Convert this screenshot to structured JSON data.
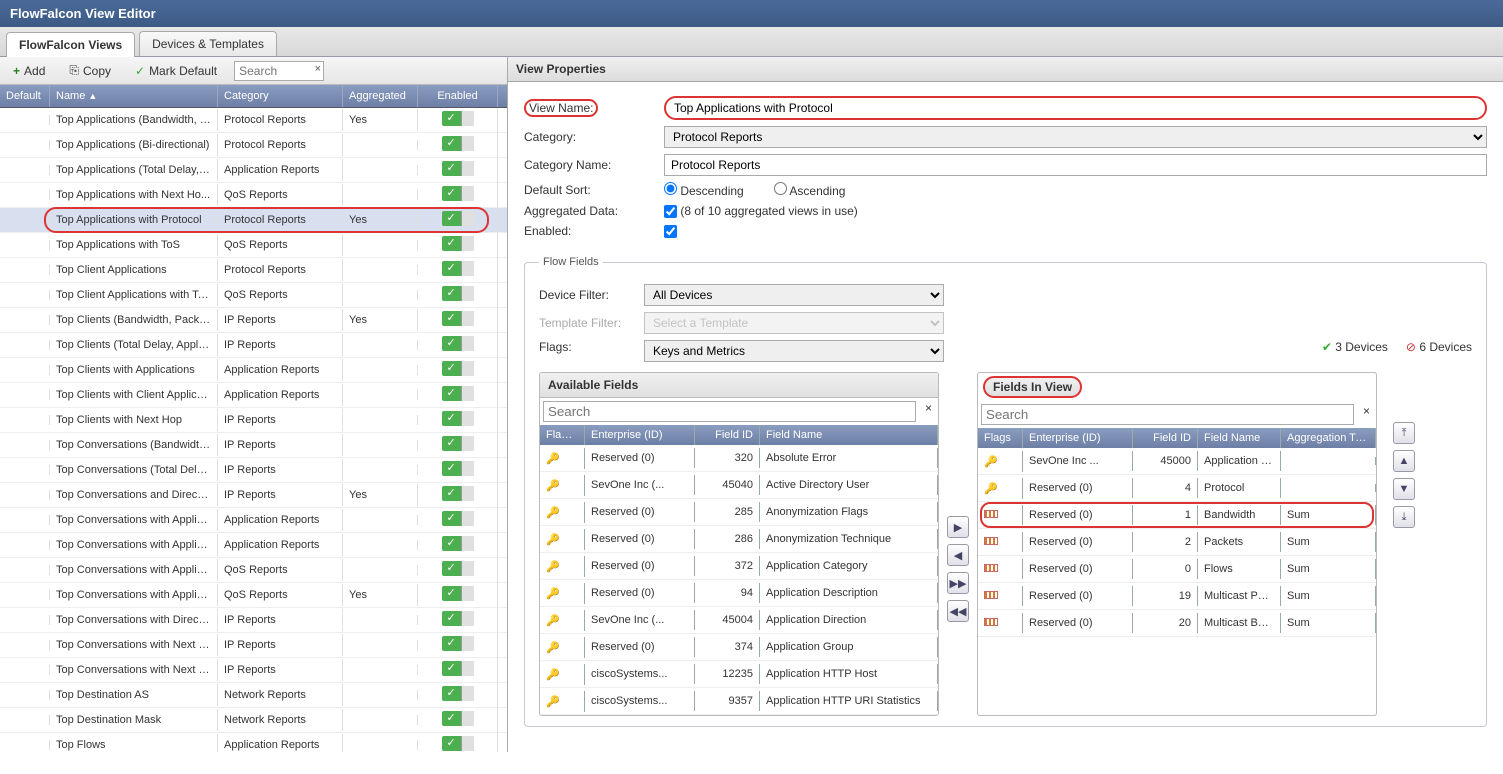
{
  "title": "FlowFalcon View Editor",
  "tabs": {
    "views": "FlowFalcon Views",
    "devices": "Devices & Templates"
  },
  "toolbar": {
    "add": "Add",
    "copy": "Copy",
    "mark": "Mark Default",
    "search_ph": "Search"
  },
  "grid": {
    "headers": {
      "default": "Default",
      "name": "Name",
      "category": "Category",
      "agg": "Aggregated",
      "enabled": "Enabled"
    },
    "rows": [
      {
        "name": "Top Applications (Bandwidth, P...",
        "cat": "Protocol Reports",
        "agg": "Yes"
      },
      {
        "name": "Top Applications (Bi-directional)",
        "cat": "Protocol Reports",
        "agg": ""
      },
      {
        "name": "Top Applications (Total Delay, ...",
        "cat": "Application Reports",
        "agg": ""
      },
      {
        "name": "Top Applications with Next Ho...",
        "cat": "QoS Reports",
        "agg": ""
      },
      {
        "name": "Top Applications with Protocol",
        "cat": "Protocol Reports",
        "agg": "Yes",
        "selected": true
      },
      {
        "name": "Top Applications with ToS",
        "cat": "QoS Reports",
        "agg": ""
      },
      {
        "name": "Top Client Applications",
        "cat": "Protocol Reports",
        "agg": ""
      },
      {
        "name": "Top Client Applications with ToS",
        "cat": "QoS Reports",
        "agg": ""
      },
      {
        "name": "Top Clients (Bandwidth, Packet...",
        "cat": "IP Reports",
        "agg": "Yes"
      },
      {
        "name": "Top Clients (Total Delay, Applic...",
        "cat": "IP Reports",
        "agg": ""
      },
      {
        "name": "Top Clients with Applications",
        "cat": "Application Reports",
        "agg": ""
      },
      {
        "name": "Top Clients with Client Applicat...",
        "cat": "Application Reports",
        "agg": ""
      },
      {
        "name": "Top Clients with Next Hop",
        "cat": "IP Reports",
        "agg": ""
      },
      {
        "name": "Top Conversations (Bandwidth,...",
        "cat": "IP Reports",
        "agg": ""
      },
      {
        "name": "Top Conversations (Total Delay...",
        "cat": "IP Reports",
        "agg": ""
      },
      {
        "name": "Top Conversations and Direction",
        "cat": "IP Reports",
        "agg": "Yes"
      },
      {
        "name": "Top Conversations with Applica...",
        "cat": "Application Reports",
        "agg": ""
      },
      {
        "name": "Top Conversations with Applica...",
        "cat": "Application Reports",
        "agg": ""
      },
      {
        "name": "Top Conversations with Applica...",
        "cat": "QoS Reports",
        "agg": ""
      },
      {
        "name": "Top Conversations with Applica...",
        "cat": "QoS Reports",
        "agg": "Yes"
      },
      {
        "name": "Top Conversations with Direction",
        "cat": "IP Reports",
        "agg": ""
      },
      {
        "name": "Top Conversations with Next H...",
        "cat": "IP Reports",
        "agg": ""
      },
      {
        "name": "Top Conversations with Next H...",
        "cat": "IP Reports",
        "agg": ""
      },
      {
        "name": "Top Destination AS",
        "cat": "Network Reports",
        "agg": ""
      },
      {
        "name": "Top Destination Mask",
        "cat": "Network Reports",
        "agg": ""
      },
      {
        "name": "Top Flows",
        "cat": "Application Reports",
        "agg": ""
      }
    ]
  },
  "props": {
    "heading": "View Properties",
    "viewname_label": "View Name:",
    "viewname": "Top Applications with Protocol",
    "category_label": "Category:",
    "category": "Protocol Reports",
    "catname_label": "Category Name:",
    "catname": "Protocol Reports",
    "sort_label": "Default Sort:",
    "sort_desc": "Descending",
    "sort_asc": "Ascending",
    "agg_label": "Aggregated Data:",
    "agg_note": "(8 of 10 aggregated views in use)",
    "enabled_label": "Enabled:"
  },
  "flowfields": {
    "legend": "Flow Fields",
    "devfilter_label": "Device Filter:",
    "devfilter": "All Devices",
    "tmplfilter_label": "Template Filter:",
    "tmplfilter_ph": "Select a Template",
    "flags_label": "Flags:",
    "flags": "Keys and Metrics",
    "status_ok": "3 Devices",
    "status_no": "6 Devices",
    "avail_title": "Available Fields",
    "inview_title": "Fields In View",
    "search_ph": "Search",
    "headers": {
      "flags": "Flags",
      "ent": "Enterprise (ID)",
      "id": "Field ID",
      "name": "Field Name",
      "aggt": "Aggregation Type"
    },
    "available": [
      {
        "ico": "key",
        "ent": "Reserved (0)",
        "id": "320",
        "name": "Absolute Error"
      },
      {
        "ico": "key",
        "ent": "SevOne Inc (...",
        "id": "45040",
        "name": "Active Directory User"
      },
      {
        "ico": "key",
        "ent": "Reserved (0)",
        "id": "285",
        "name": "Anonymization Flags"
      },
      {
        "ico": "key",
        "ent": "Reserved (0)",
        "id": "286",
        "name": "Anonymization Technique"
      },
      {
        "ico": "key",
        "ent": "Reserved (0)",
        "id": "372",
        "name": "Application Category"
      },
      {
        "ico": "key",
        "ent": "Reserved (0)",
        "id": "94",
        "name": "Application Description"
      },
      {
        "ico": "key",
        "ent": "SevOne Inc (...",
        "id": "45004",
        "name": "Application Direction"
      },
      {
        "ico": "key",
        "ent": "Reserved (0)",
        "id": "374",
        "name": "Application Group"
      },
      {
        "ico": "key",
        "ent": "ciscoSystems...",
        "id": "12235",
        "name": "Application HTTP Host"
      },
      {
        "ico": "key",
        "ent": "ciscoSystems...",
        "id": "9357",
        "name": "Application HTTP URI Statistics"
      }
    ],
    "inview": [
      {
        "ico": "key",
        "ent": "SevOne Inc ...",
        "id": "45000",
        "name": "Application Port",
        "agg": ""
      },
      {
        "ico": "key",
        "ent": "Reserved (0)",
        "id": "4",
        "name": "Protocol",
        "agg": ""
      },
      {
        "ico": "bar",
        "ent": "Reserved (0)",
        "id": "1",
        "name": "Bandwidth",
        "agg": "Sum",
        "hl": true
      },
      {
        "ico": "bar",
        "ent": "Reserved (0)",
        "id": "2",
        "name": "Packets",
        "agg": "Sum"
      },
      {
        "ico": "bar",
        "ent": "Reserved (0)",
        "id": "0",
        "name": "Flows",
        "agg": "Sum"
      },
      {
        "ico": "bar",
        "ent": "Reserved (0)",
        "id": "19",
        "name": "Multicast Packets",
        "agg": "Sum"
      },
      {
        "ico": "bar",
        "ent": "Reserved (0)",
        "id": "20",
        "name": "Multicast Bandwid...",
        "agg": "Sum"
      }
    ]
  }
}
